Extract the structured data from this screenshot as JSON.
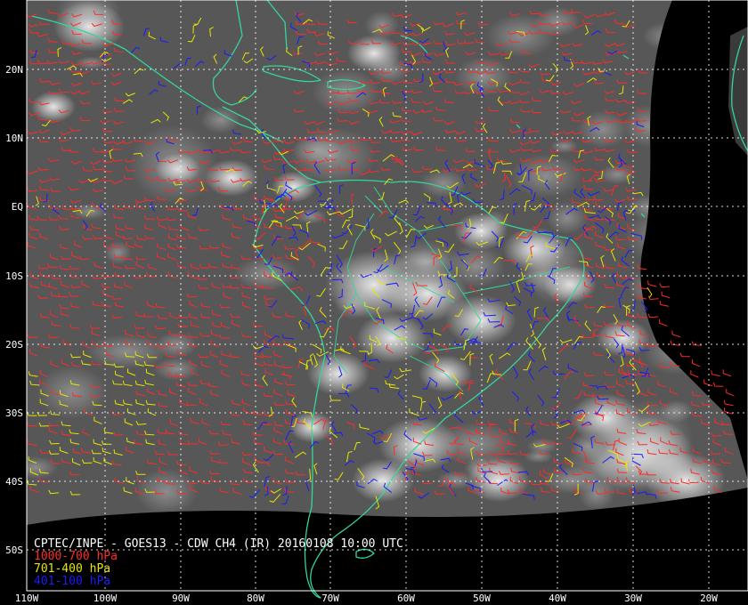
{
  "map": {
    "title": "CPTEC/INPE - GOES13 - CDW CH4 (IR) 20160108 10:00 UTC",
    "latitude_labels": [
      "20N",
      "10N",
      "EQ",
      "10S",
      "20S",
      "30S",
      "40S",
      "50S"
    ],
    "longitude_labels": [
      "110W",
      "100W",
      "90W",
      "80W",
      "70W",
      "60W",
      "50W",
      "40W",
      "30W",
      "20W"
    ],
    "colors": {
      "background": "#000000",
      "coastline": "#33d69b",
      "grid": "#ffffff",
      "text": "#ffffff"
    },
    "legend": [
      {
        "label": "1000-700 hPa",
        "color": "#ff2a2a"
      },
      {
        "label": "701-400 hPa",
        "color": "#e6e600"
      },
      {
        "label": "401-100 hPa",
        "color": "#1a1aff"
      }
    ]
  }
}
